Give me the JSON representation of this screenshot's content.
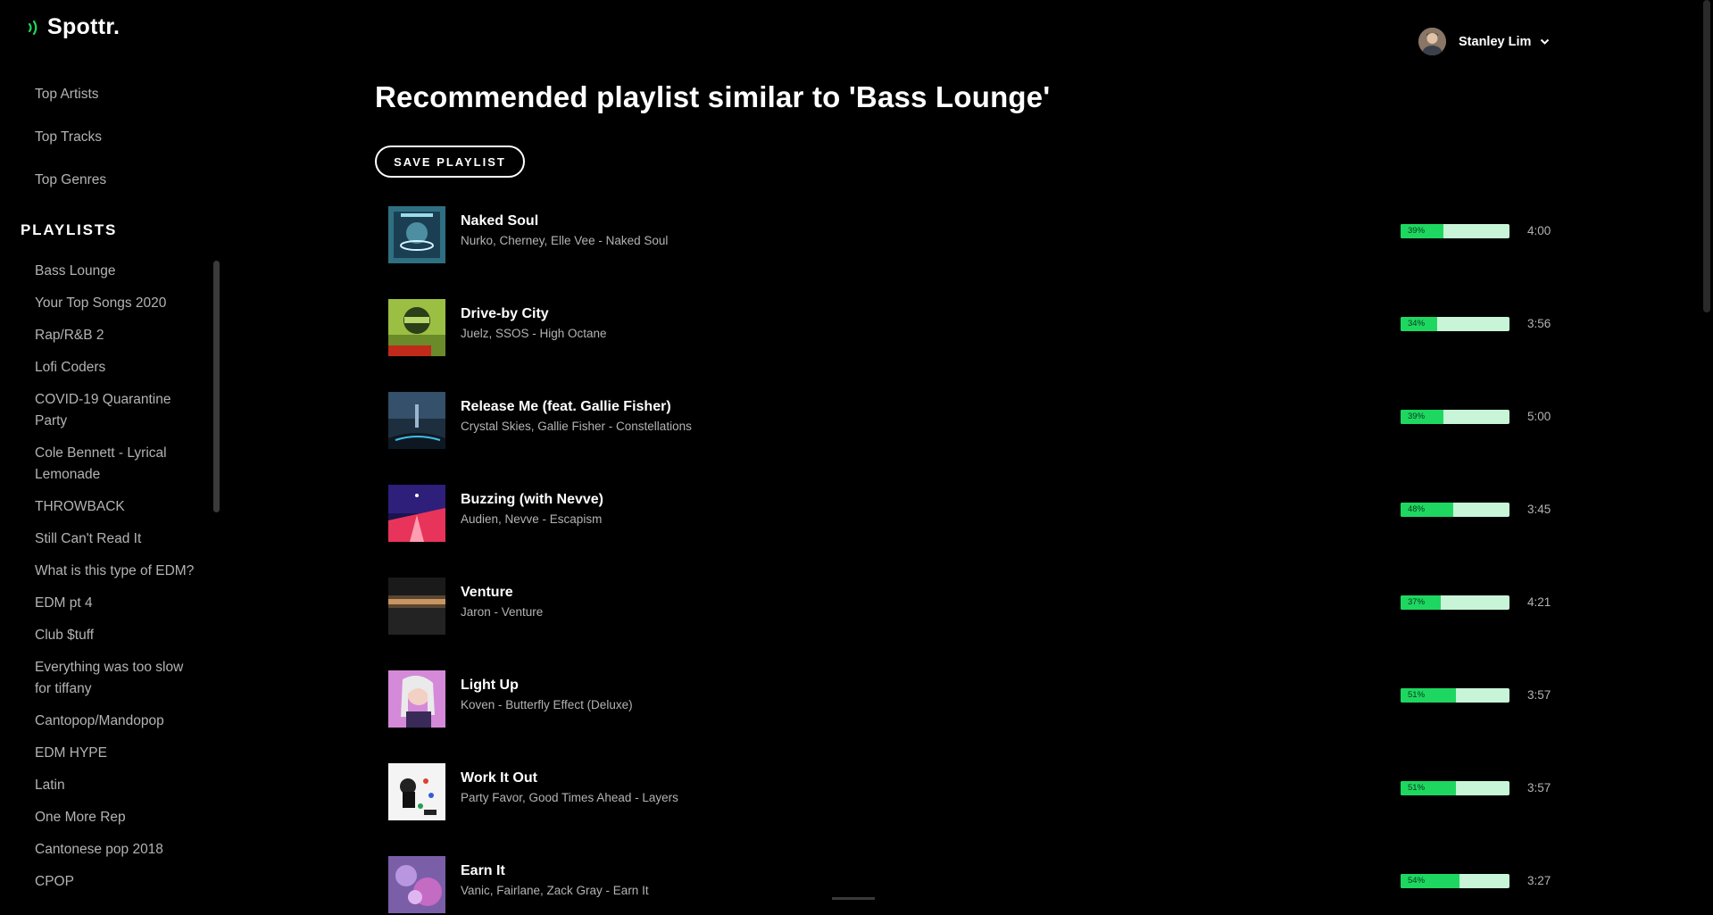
{
  "app": {
    "brand": "Spottr.",
    "accent_color": "#1ed760"
  },
  "sidebar": {
    "nav": [
      {
        "label": "Top Artists"
      },
      {
        "label": "Top Tracks"
      },
      {
        "label": "Top Genres"
      }
    ],
    "playlists_heading": "PLAYLISTS",
    "playlists": [
      "Bass Lounge",
      "Your Top Songs 2020",
      "Rap/R&B 2",
      "Lofi Coders",
      "COVID-19 Quarantine Party",
      "Cole Bennett - Lyrical Lemonade",
      "THROWBACK",
      "Still Can't Read It",
      "What is this type of EDM?",
      "EDM pt 4",
      "Club $tuff",
      "Everything was too slow for tiffany",
      "Cantopop/Mandopop",
      "EDM HYPE",
      "Latin",
      "One More Rep",
      "Cantonese pop 2018",
      "CPOP"
    ]
  },
  "user": {
    "name": "Stanley Lim",
    "menu_icon": "chevron-down-icon"
  },
  "main": {
    "title": "Recommended playlist similar to 'Bass Lounge'",
    "save_label": "SAVE PLAYLIST",
    "tracks": [
      {
        "title": "Naked Soul",
        "subtitle": "Nurko, Cherney, Elle Vee - Naked Soul",
        "match": "39%",
        "match_value": 39,
        "duration": "4:00"
      },
      {
        "title": "Drive-by City",
        "subtitle": "Juelz, SSOS - High Octane",
        "match": "34%",
        "match_value": 34,
        "duration": "3:56"
      },
      {
        "title": "Release Me (feat. Gallie Fisher)",
        "subtitle": "Crystal Skies, Gallie Fisher - Constellations",
        "match": "39%",
        "match_value": 39,
        "duration": "5:00"
      },
      {
        "title": "Buzzing (with Nevve)",
        "subtitle": "Audien, Nevve - Escapism",
        "match": "48%",
        "match_value": 48,
        "duration": "3:45"
      },
      {
        "title": "Venture",
        "subtitle": "Jaron - Venture",
        "match": "37%",
        "match_value": 37,
        "duration": "4:21"
      },
      {
        "title": "Light Up",
        "subtitle": "Koven - Butterfly Effect (Deluxe)",
        "match": "51%",
        "match_value": 51,
        "duration": "3:57"
      },
      {
        "title": "Work It Out",
        "subtitle": "Party Favor, Good Times Ahead - Layers",
        "match": "51%",
        "match_value": 51,
        "duration": "3:57"
      },
      {
        "title": "Earn It",
        "subtitle": "Vanic, Fairlane, Zack Gray - Earn It",
        "match": "54%",
        "match_value": 54,
        "duration": "3:27"
      }
    ]
  }
}
